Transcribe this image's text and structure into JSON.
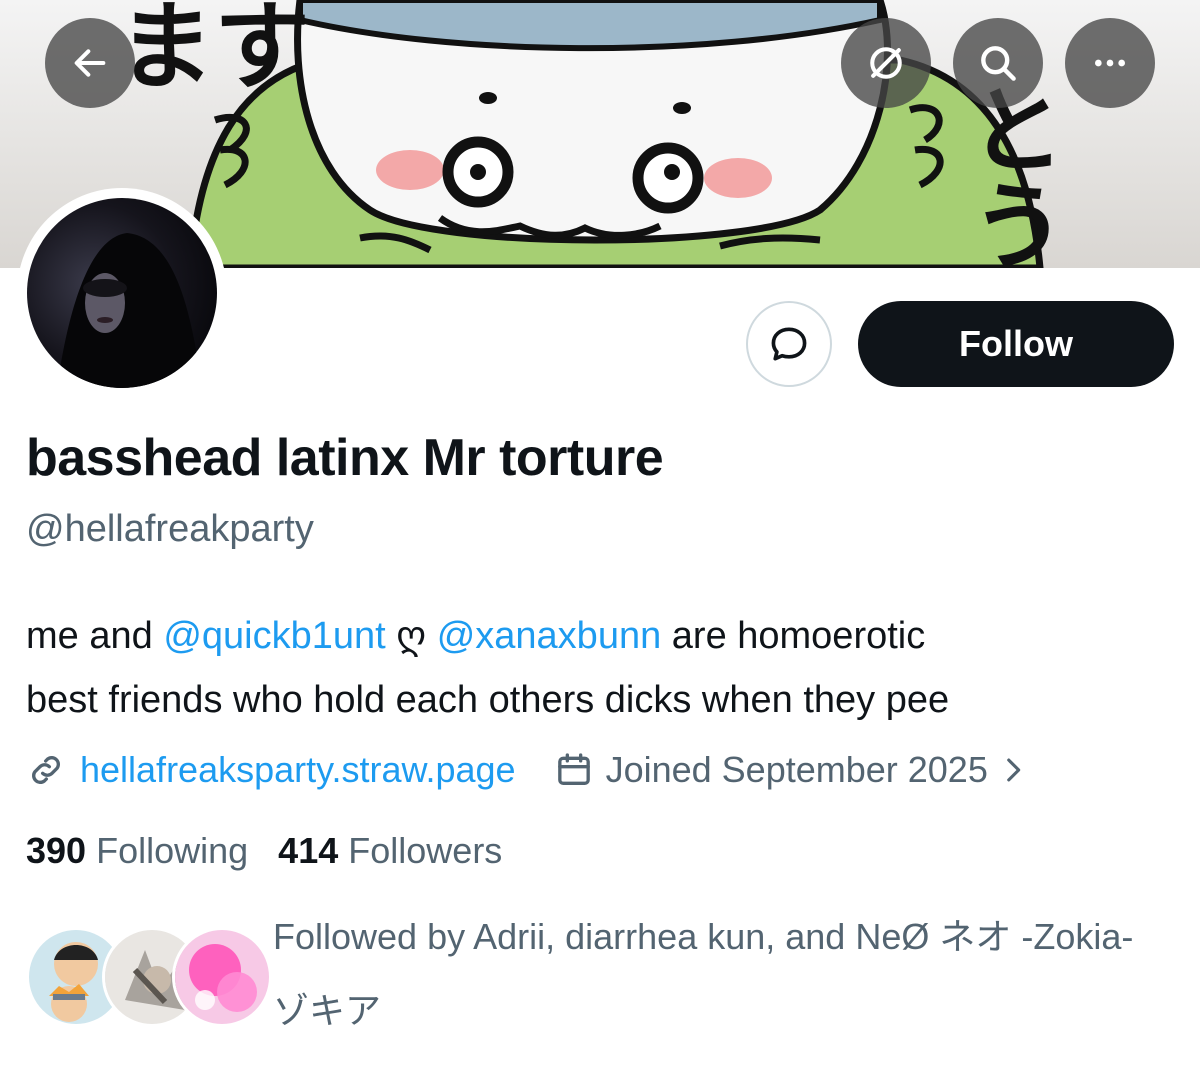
{
  "nav": {
    "back_icon": "arrow-left-icon",
    "grok_icon": "slash-circle-icon",
    "search_icon": "search-icon",
    "more_icon": "more-horizontal-icon"
  },
  "banner": {
    "left_glyphs": "ます",
    "right_glyphs": "とう"
  },
  "actions": {
    "message_icon": "message-bubble-icon",
    "follow_label": "Follow"
  },
  "profile": {
    "display_name": "basshead latinx Mr torture",
    "handle": "@hellafreakparty",
    "bio": {
      "part1": "me and ",
      "mention1": "@quickb1unt",
      "heart": " ღ ",
      "mention2": "@xanaxbunn",
      "part2": " are homoerotic",
      "line2": "best friends who hold each others dicks when they pee"
    },
    "website": "hellafreaksparty.straw.page",
    "joined": "Joined September 2025",
    "link_icon": "link-icon",
    "calendar_icon": "calendar-icon",
    "chevron_icon": "chevron-right-icon"
  },
  "stats": {
    "following_count": "390",
    "following_label": "Following",
    "followers_count": "414",
    "followers_label": "Followers"
  },
  "followed_by": {
    "text": "Followed by Adrii, diarrhea kun, and NeØ ネオ -Zokia- ゾキア"
  },
  "colors": {
    "accent": "#1d9bf0",
    "text_primary": "#0f1419",
    "text_secondary": "#536471",
    "button_dark": "#0f1419"
  }
}
